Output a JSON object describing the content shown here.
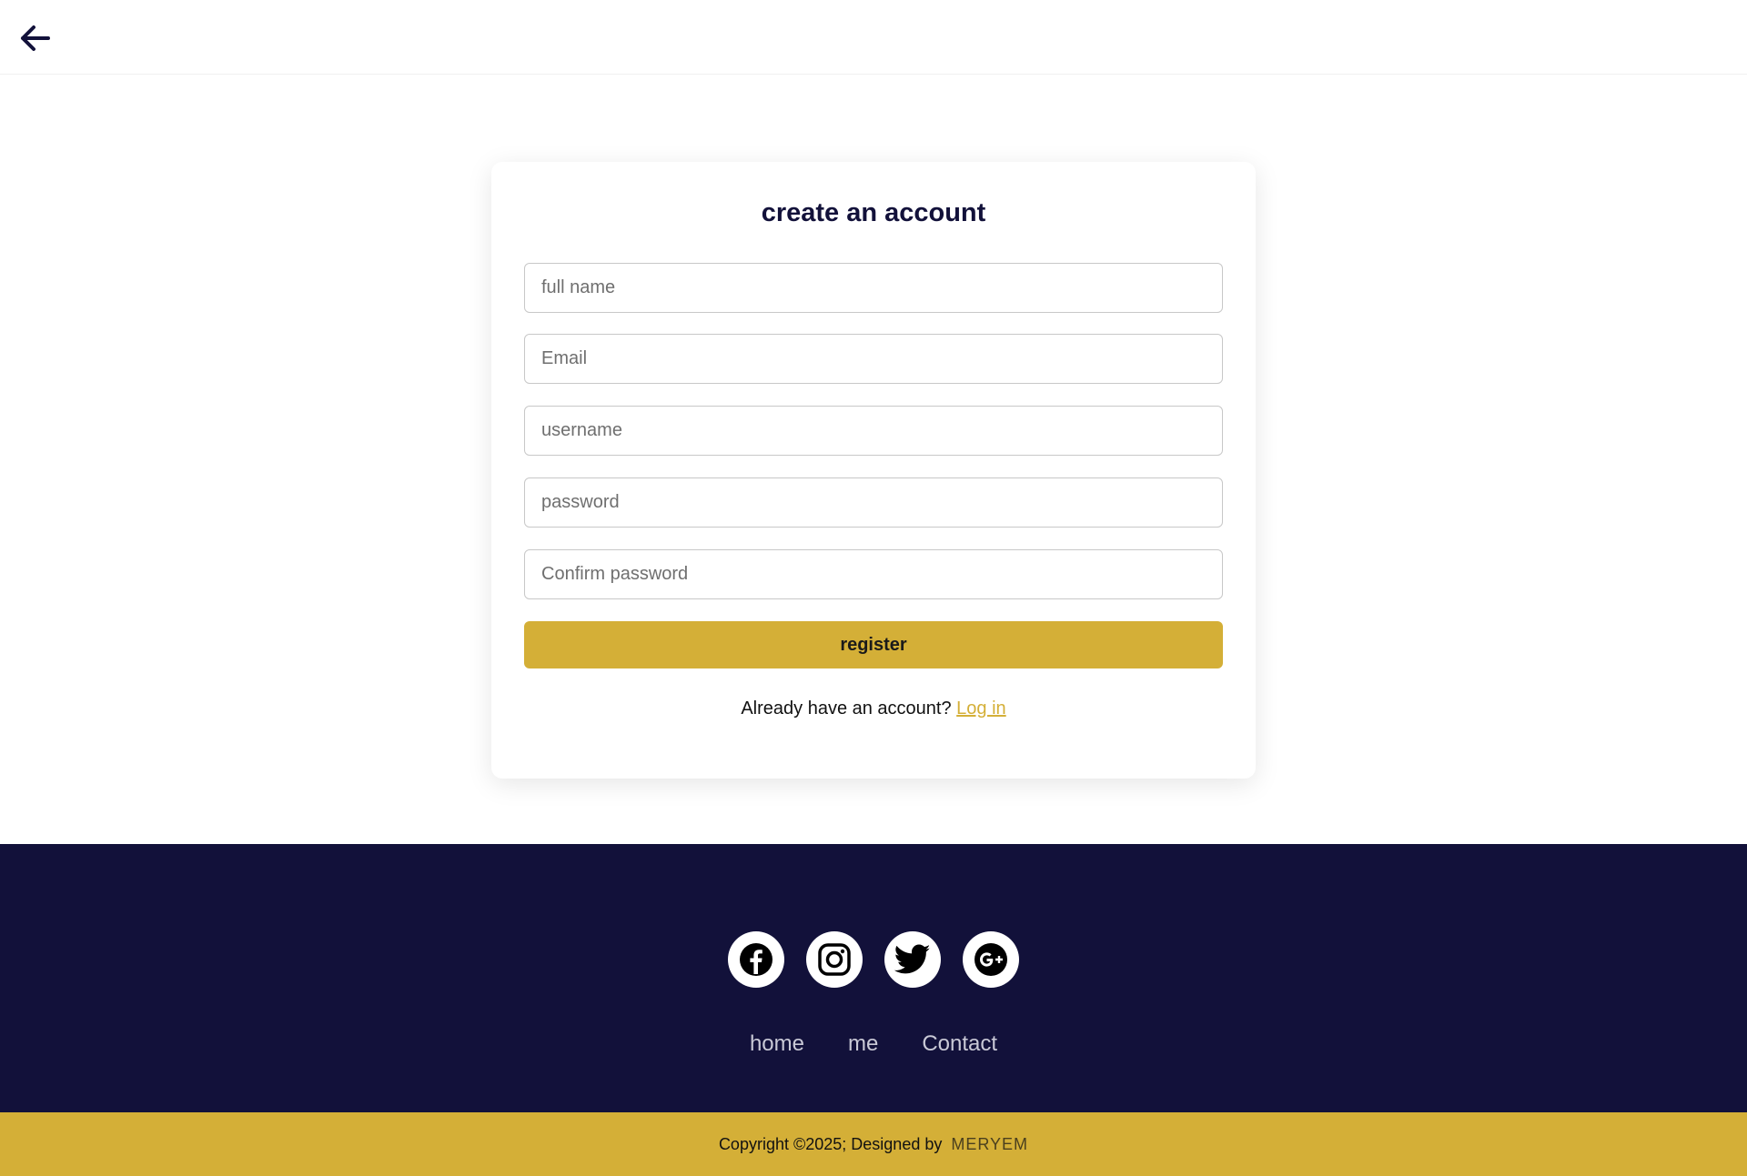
{
  "header": {
    "back_icon": "arrow-left-icon"
  },
  "form": {
    "title": "create an account",
    "fields": {
      "full_name": {
        "placeholder": "full name",
        "value": ""
      },
      "email": {
        "placeholder": "Email",
        "value": ""
      },
      "username": {
        "placeholder": "username",
        "value": ""
      },
      "password": {
        "placeholder": "password",
        "value": ""
      },
      "confirm_password": {
        "placeholder": "Confirm password",
        "value": ""
      }
    },
    "register_label": "register",
    "login_prompt": "Already have an account?",
    "login_link": "Log in"
  },
  "footer": {
    "socials": [
      "facebook-icon",
      "instagram-icon",
      "twitter-icon",
      "google-plus-icon"
    ],
    "nav": [
      "home",
      "me",
      "Contact"
    ],
    "copyright": "Copyright ©2025; Designed by",
    "designer": "MERYEM"
  },
  "colors": {
    "brand_navy": "#12113a",
    "accent_gold": "#d4af37",
    "background": "#ffffff"
  }
}
